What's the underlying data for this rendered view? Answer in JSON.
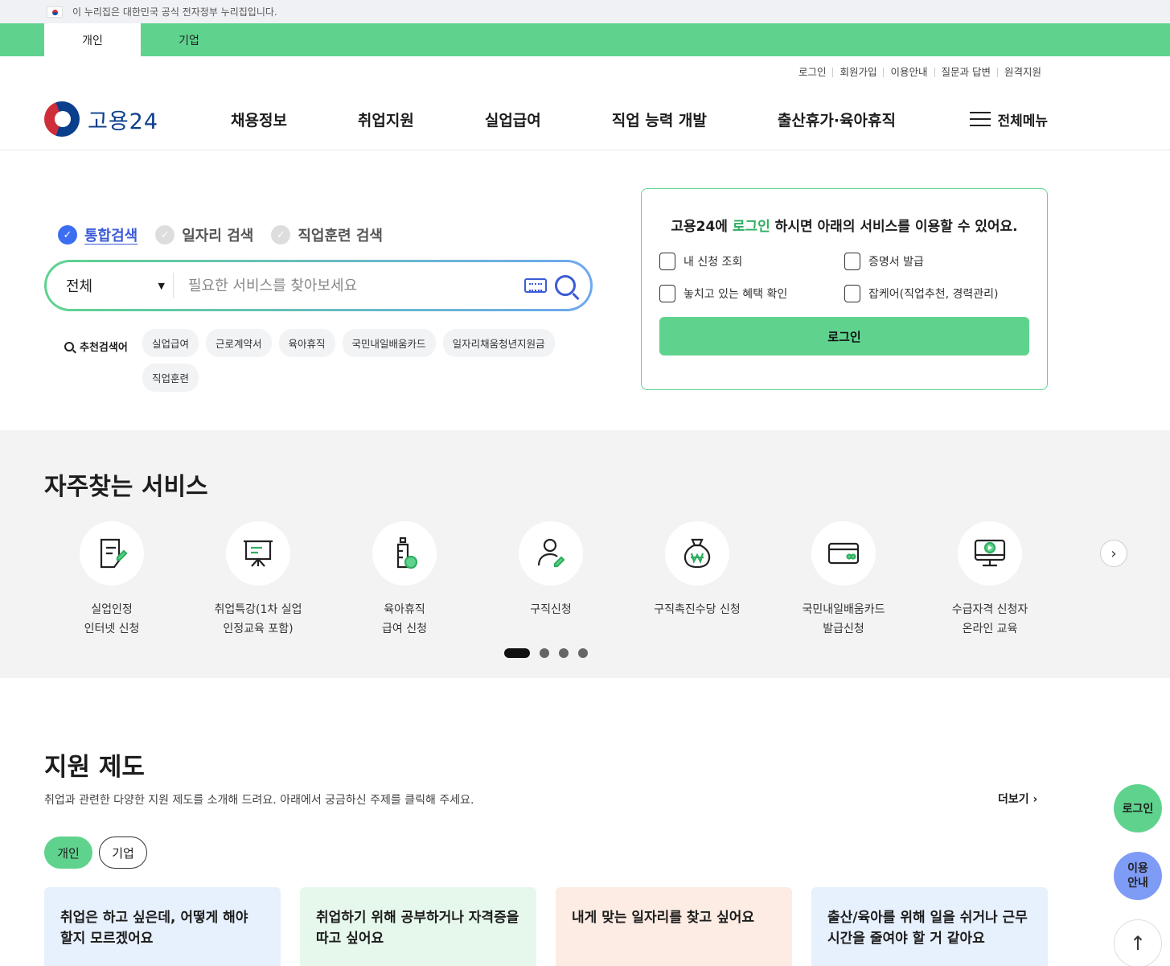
{
  "gov_banner": {
    "text": "이 누리집은 대한민국 공식 전자정부 누리집입니다."
  },
  "user_tabs": [
    "개인",
    "기업"
  ],
  "util_links": [
    "로그인",
    "회원가입",
    "이용안내",
    "질문과 답변",
    "원격지원"
  ],
  "logo": {
    "text": "고용24"
  },
  "nav": [
    "채용정보",
    "취업지원",
    "실업급여",
    "직업 능력 개발",
    "출산휴가·육아휴직"
  ],
  "all_menu": "전체메뉴",
  "search": {
    "types": [
      "통합검색",
      "일자리 검색",
      "직업훈련 검색"
    ],
    "scope": "전체",
    "placeholder": "필요한 서비스를 찾아보세요",
    "recommend_label": "추천검색어",
    "keywords": [
      "실업급여",
      "근로계약서",
      "육아휴직",
      "국민내일배움카드",
      "일자리채움청년지원금",
      "직업훈련"
    ]
  },
  "login_card": {
    "title_pre": "고용24에 ",
    "title_highlight": "로그인",
    "title_post": " 하시면 아래의 서비스를 이용할 수 있어요.",
    "items": [
      "내 신청 조회",
      "증명서 발급",
      "놓치고 있는 혜택 확인",
      "잡케어(직업추천, 경력관리)"
    ],
    "button": "로그인"
  },
  "frequent": {
    "title": "자주찾는 서비스",
    "services": [
      {
        "label": "실업인정\n인터넷 신청",
        "icon": "document-pen-icon"
      },
      {
        "label": "취업특강(1차 실업\n인정교육 포함)",
        "icon": "presentation-board-icon"
      },
      {
        "label": "육아휴직\n급여 신청",
        "icon": "baby-bottle-icon"
      },
      {
        "label": "구직신청",
        "icon": "person-pen-icon"
      },
      {
        "label": "구직촉진수당 신청",
        "icon": "money-bag-icon"
      },
      {
        "label": "국민내일배움카드\n발급신청",
        "icon": "card-icon"
      },
      {
        "label": "수급자격 신청자\n온라인 교육",
        "icon": "monitor-play-icon"
      }
    ]
  },
  "support": {
    "title": "지원 제도",
    "desc": "취업과 관련한 다양한 지원 제도를 소개해 드려요. 아래에서 궁금하신 주제를 클릭해 주세요.",
    "more": "더보기",
    "tabs": [
      "개인",
      "기업"
    ],
    "cards": [
      {
        "title": "취업은 하고 싶은데, 어떻게 해야 할지 모르겠어요",
        "color": "#e7f0fd"
      },
      {
        "title": "취업하기 위해 공부하거나 자격증을 따고 싶어요",
        "color": "#e6f8ec"
      },
      {
        "title": "내게 맞는 일자리를 찾고 싶어요",
        "color": "#fdece3"
      },
      {
        "title": "출산/육아를 위해 일을 쉬거나 근무시간을 줄여야 할 거 같아요",
        "color": "#e7f0fd"
      }
    ]
  },
  "floating": {
    "login": "로그인",
    "guide": "이용\n안내"
  }
}
